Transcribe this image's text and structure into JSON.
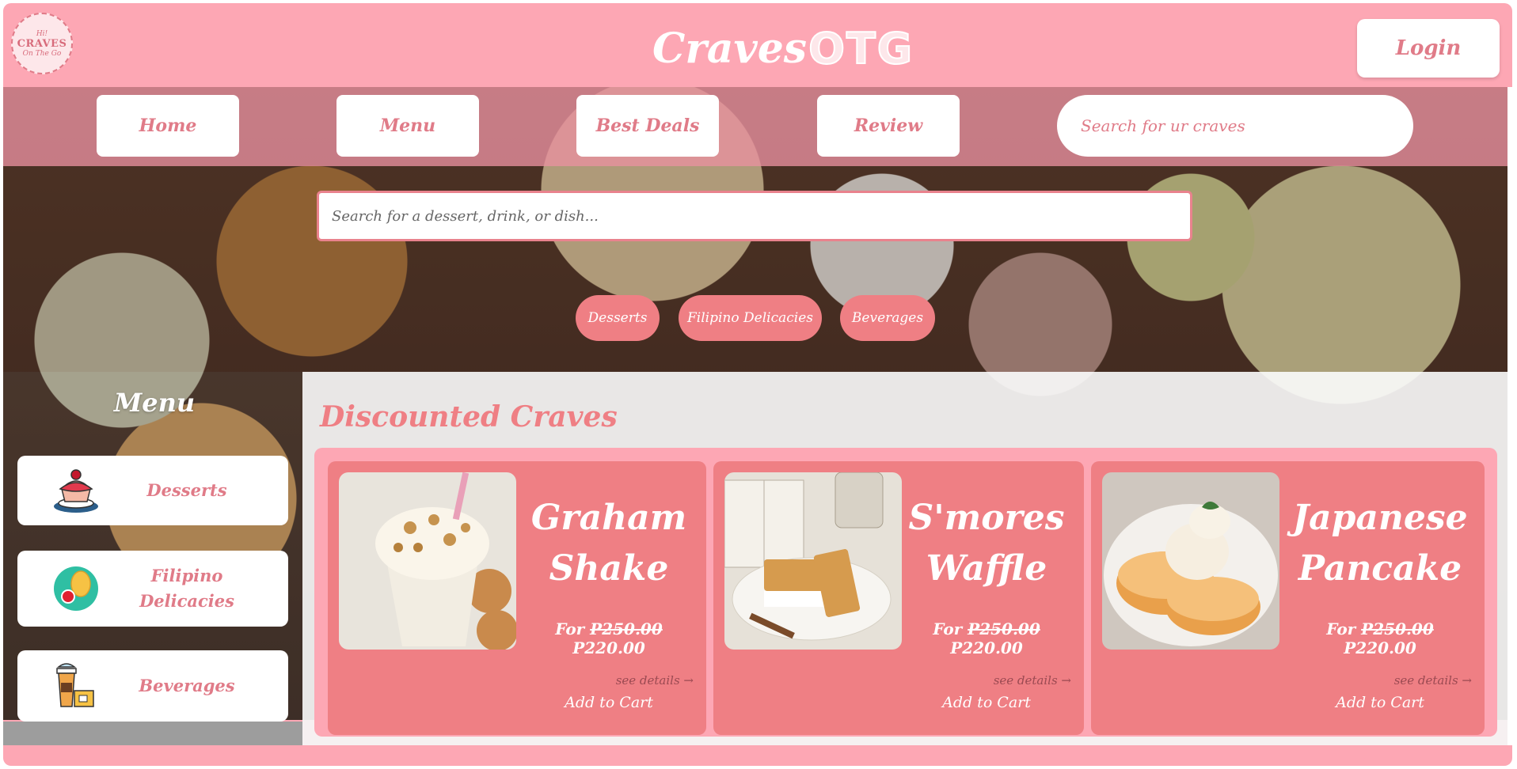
{
  "header": {
    "logo": {
      "top_text": "Hi!",
      "main_text": "CRAVES",
      "bottom_text": "On The Go"
    },
    "brand": {
      "craves": "Craves",
      "otg": "OTG"
    },
    "login_label": "Login"
  },
  "nav": {
    "items": [
      {
        "label": "Home"
      },
      {
        "label": "Menu"
      },
      {
        "label": "Best Deals"
      },
      {
        "label": "Review"
      }
    ],
    "search_placeholder": "Search for ur craves"
  },
  "hero": {
    "search_placeholder": "Search for a dessert, drink, or dish...",
    "categories": [
      {
        "label": "Desserts"
      },
      {
        "label": "Filipino Delicacies"
      },
      {
        "label": "Beverages"
      }
    ]
  },
  "sidebar": {
    "title": "Menu",
    "items": [
      {
        "label": "Desserts",
        "icon": "cupcake-icon"
      },
      {
        "label": "Filipino Delicacies",
        "icon": "mango-icon"
      },
      {
        "label": "Beverages",
        "icon": "coffee-icon"
      }
    ]
  },
  "discounted": {
    "title": "Discounted Craves",
    "cards": [
      {
        "name_line1": "Graham",
        "name_line2": "Shake",
        "prefix": "For",
        "old_price": "P250.00",
        "new_price": "P220.00",
        "details": "see details →",
        "cart": "Add to Cart"
      },
      {
        "name_line1": "S'mores",
        "name_line2": "Waffle",
        "prefix": "For",
        "old_price": "P250.00",
        "new_price": "P220.00",
        "details": "see details →",
        "cart": "Add to Cart"
      },
      {
        "name_line1": "Japanese",
        "name_line2": "Pancake",
        "prefix": "For",
        "old_price": "P250.00",
        "new_price": "P220.00",
        "details": "see details →",
        "cart": "Add to Cart"
      }
    ]
  },
  "colors": {
    "pink_light": "#fda7b4",
    "pink_accent": "#ef7f84",
    "text_pink": "#e07b88"
  }
}
